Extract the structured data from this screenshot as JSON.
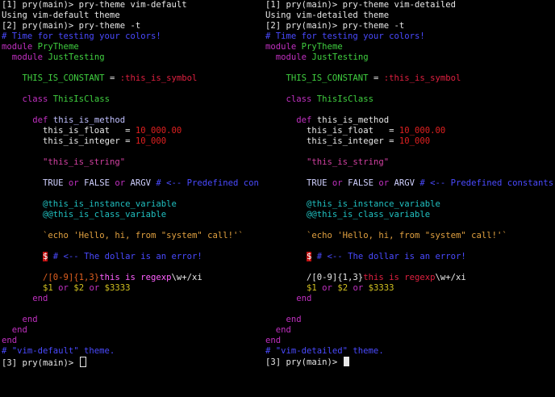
{
  "left": {
    "prompt1": "[1] pry(main)> pry-theme vim-default",
    "using": "Using vim-default theme",
    "prompt2": "[2] pry(main)> pry-theme -t",
    "comment_top": "# Time for testing your colors!",
    "module1_kw": "module",
    "module1_name": "PryTheme",
    "module2_kw": "module",
    "module2_name": "JustTesting",
    "const": "THIS_IS_CONSTANT",
    "assign": " = ",
    "symbol": ":this_is_symbol",
    "class_kw": "class",
    "class_name": "ThisIsClass",
    "def_kw": "def",
    "def_name": "this_is_method",
    "float_var": "this_is_float   = ",
    "float_val": "10_000.00",
    "int_var": "this_is_integer = ",
    "int_val": "10_000",
    "string": "\"this_is_string\"",
    "true_kw": "TRUE",
    "or1": " or ",
    "false_kw": "FALSE",
    "or2": " or ",
    "argv": "ARGV",
    "predef_comment": " # <-- Predefined consta",
    "ivar": "@this_is_instance_variable",
    "cvar": "@@this_is_class_variable",
    "shell": "`echo 'Hello, hi, from \"system\" call!'`",
    "dollar": "$",
    "dollar_comment": " # <-- The dollar is an error!",
    "regex1": "/[0-9]{1,3}",
    "regex2": "this is regexp",
    "regex3": "\\w+/xi",
    "gvar1": "$1",
    "gor1": " or ",
    "gvar2": "$2",
    "gor2": " or ",
    "gvar3": "$3333",
    "end1": "end",
    "end2": "end",
    "end3": "end",
    "end4": "end",
    "comment_bottom": "# \"vim-default\" theme.",
    "prompt3": "[3] pry(main)> "
  },
  "right": {
    "prompt1": "[1] pry(main)> pry-theme vim-detailed",
    "using": "Using vim-detailed theme",
    "prompt2": "[2] pry(main)> pry-theme -t",
    "comment_top": "# Time for testing your colors!",
    "module1_kw": "module",
    "module1_name": "PryTheme",
    "module2_kw": "module",
    "module2_name": "JustTesting",
    "const": "THIS_IS_CONSTANT",
    "assign": " = ",
    "symbol": ":this_is_symbol",
    "class_kw": "class",
    "class_name": "ThisIsClass",
    "def_kw": "def",
    "def_name": "this_is_method",
    "float_var": "this_is_float   = ",
    "float_val": "10_000.00",
    "int_var": "this_is_integer = ",
    "int_val": "10_000",
    "string": "\"this_is_string\"",
    "true_kw": "TRUE",
    "or1": " or ",
    "false_kw": "FALSE",
    "or2": " or ",
    "argv": "ARGV",
    "predef_comment": " # <-- Predefined constants",
    "ivar": "@this_is_instance_variable",
    "cvar": "@@this_is_class_variable",
    "shell": "`echo 'Hello, hi, from \"system\" call!'`",
    "dollar": "$",
    "dollar_comment": " # <-- The dollar is an error!",
    "regex1": "/[0-9]{1,3}",
    "regex2": "this is regexp",
    "regex3": "\\w+/xi",
    "gvar1": "$1",
    "gor1": " or ",
    "gvar2": "$2",
    "gor2": " or ",
    "gvar3": "$3333",
    "end1": "end",
    "end2": "end",
    "end3": "end",
    "end4": "end",
    "comment_bottom": "# \"vim-detailed\" theme.",
    "prompt3": "[3] pry(main)> "
  }
}
